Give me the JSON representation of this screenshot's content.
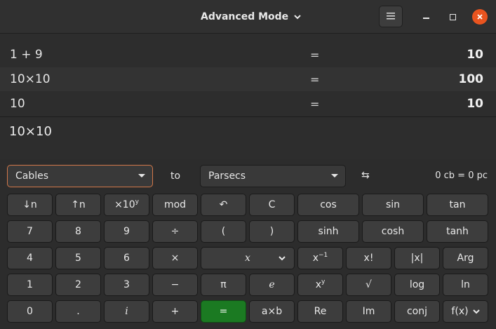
{
  "header": {
    "title": "Advanced Mode",
    "title_chevron_icon": "chevron-down-icon",
    "menu_icon": "hamburger-menu-icon",
    "minimize_icon": "minimize-icon",
    "maximize_icon": "maximize-icon",
    "close_icon": "close-icon",
    "close_color": "#e9541f"
  },
  "history": [
    {
      "expr": "1 + 9",
      "eq": "=",
      "result": "10"
    },
    {
      "expr": "10×10",
      "eq": "=",
      "result": "100"
    },
    {
      "expr": "10",
      "eq": "=",
      "result": "10"
    }
  ],
  "entry": {
    "text": "10×10"
  },
  "converter": {
    "from_unit": "Cables",
    "to_label": "to",
    "to_unit": "Parsecs",
    "swap_icon": "⇆",
    "result": "0 cb  =  0 pc"
  },
  "keypad": {
    "row1": [
      "↓n",
      "↑n",
      "×10",
      "mod",
      "↶",
      "C",
      "cos",
      "sin",
      "tan"
    ],
    "row1_sup": "y",
    "row2": [
      "7",
      "8",
      "9",
      "÷",
      "(",
      ")",
      "sinh",
      "cosh",
      "tanh"
    ],
    "row3": [
      "4",
      "5",
      "6",
      "×",
      "x",
      "x",
      "x!",
      "|x|",
      "Arg"
    ],
    "row3_sup": "−1",
    "row4": [
      "1",
      "2",
      "3",
      "−",
      "π",
      "e",
      "x",
      "√",
      "log",
      "ln"
    ],
    "row4_sup": "y",
    "row5": [
      "0",
      ".",
      "i",
      "+",
      "=",
      "a×b",
      "Re",
      "Im",
      "conj",
      "f(x)"
    ],
    "equals_color": "#1b7a22"
  }
}
